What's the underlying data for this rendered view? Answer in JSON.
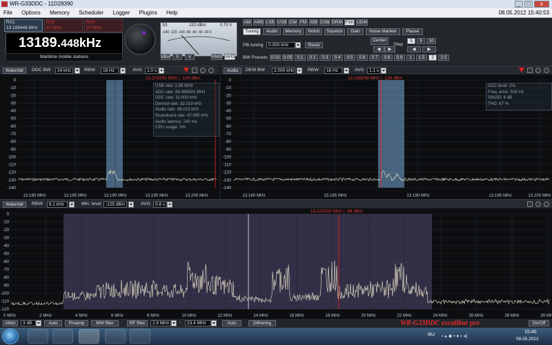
{
  "window": {
    "title": "WR-G33DDC - 11D28390",
    "clock": "08.05.2012 15:40:53"
  },
  "menu": [
    "File",
    "Options",
    "Memory",
    "Scheduler",
    "Logger",
    "Plugins",
    "Help"
  ],
  "receiver": {
    "rx1_label": "RX1",
    "rx1_freq": "13.189448 MHz",
    "rx2_label": "RX2",
    "rx2_freq": "10 MHz",
    "rx3_label": "RX3",
    "rx3_freq": "10 MHz",
    "frequency_main": "13189.",
    "frequency_fine": "448",
    "frequency_unit": "kHz",
    "station": "Maritime mobile stations"
  },
  "smeter": {
    "s_label": "S3",
    "dbm": "-110 dBm",
    "volts": "0.70 V",
    "scale": "-140 -120 -100 -80 -60 -40 -20 0",
    "dbm_btn": "dBm",
    "s_btn": "S",
    "v_btn": "V",
    "rms_btn": "RMS",
    "avg_btn": "AVG"
  },
  "modes": [
    "AM",
    "AMS",
    "LSB",
    "USB",
    "CW",
    "FM",
    "ISB",
    "DSB",
    "DRM",
    "FSK",
    "UDM"
  ],
  "active_mode": "FSK",
  "tabs": [
    "Tuning",
    "Audio",
    "Memory",
    "Notch",
    "Squelch",
    "Gain",
    "Noise blanker",
    "Pause"
  ],
  "pb": {
    "label": "PB tuning",
    "value": "0.000 kHz",
    "reset": "Reset"
  },
  "bw": {
    "label": "BW Presets",
    "presets": [
      "0.02",
      "0.05",
      "0.1",
      "0.2",
      "0.3",
      "0.4",
      "0.5",
      "0.6",
      "0.7",
      "0.8",
      "0.9",
      "1",
      "1.5",
      "2",
      "2.5"
    ],
    "selected": "2"
  },
  "center": {
    "label": "Center",
    "step_label": "Step",
    "steps": [
      "5",
      "9",
      "10"
    ]
  },
  "ddc_panel": {
    "mode": "Waterfall",
    "ddc_label": "DDC BW",
    "ddc_value": "24 kHz",
    "rbw_label": "RBW",
    "rbw_value": "16 Hz",
    "avg_label": "AVG",
    "avg_value": "1.0 s",
    "marker": "13.201000 MHz | -139 dBm",
    "info": [
      "USB rate: 2.99 MHz",
      "ADC rate: 99.998591 MHz",
      "DDC rate: 32.000 kHz",
      "Demod rate: 32.019 kHz",
      "Audio rate: 48.013 kHz",
      "Soundcard rate: 47.995 kHz",
      "Audio latency: 240 ms",
      "CPU usage: 3%"
    ],
    "y_ticks": [
      "0",
      "-10",
      "-20",
      "-30",
      "-40",
      "-50",
      "-60",
      "-70",
      "-80",
      "-90",
      "-100",
      "-110",
      "-120",
      "-130",
      "-140"
    ],
    "x_ticks": [
      "13.180 MHz",
      "13.185 MHz",
      "13.190 MHz",
      "13.195 MHz",
      "13.200 MHz"
    ]
  },
  "audio_panel": {
    "mode": "Audio",
    "dem_label": "DEM BW",
    "dem_value": "2.000 kHz",
    "rbw_label": "RBW",
    "rbw_value": "16 Hz",
    "avg_label": "AVG",
    "avg_value": "1.1 s",
    "marker": "13.188248 MHz | -126 dBm",
    "info": [
      "ADC level: 2%",
      "Freq. error: 539 Hz",
      "SINAD: 4 dB",
      "THD: 67 %"
    ],
    "y_ticks": [
      "0",
      "-10",
      "-20",
      "-30",
      "-40",
      "-50",
      "-60",
      "-70",
      "-80",
      "-90",
      "-100",
      "-110",
      "-120",
      "-130",
      "-140"
    ],
    "x_ticks": [
      "13.180 MHz",
      "13.185 MHz",
      "13.190 MHz",
      "13.195 MHz",
      "13.200 MHz"
    ]
  },
  "wide_panel": {
    "mode": "Waterfall",
    "rbw_label": "RBW",
    "rbw_value": "6.1 kHz",
    "min_label": "Min. level",
    "min_value": "-125 dBm",
    "avg_label": "AVG",
    "avg_value": "0.8 s",
    "marker": "18.225419 MHz | -98 dBm",
    "y_ticks": [
      "0",
      "-10",
      "-20",
      "-30",
      "-40",
      "-50",
      "-60",
      "-70",
      "-80",
      "-90",
      "-100",
      "-110",
      "-120"
    ],
    "x_ticks": [
      "0 MHz",
      "2 MHz",
      "4 MHz",
      "6 MHz",
      "8 MHz",
      "10 MHz",
      "12 MHz",
      "14 MHz",
      "16 MHz",
      "18 MHz",
      "20 MHz",
      "22 MHz",
      "24 MHz",
      "26 MHz",
      "28 MHz",
      "30 MHz"
    ]
  },
  "bottom": {
    "atten": "Atten",
    "atten_val": "3 dB",
    "auto1": "Auto",
    "preamp": "Preamp",
    "mw": "MW filter",
    "rf": "RF filter",
    "rf_low": "2.9 MHz",
    "rf_high": "23.4 MHz",
    "auto2": "Auto",
    "dither": "Dithering",
    "onoff": "On/Off"
  },
  "brand": "WR-G33DDC  excalibur pro",
  "tray": {
    "lang": "RU",
    "time": "15:40",
    "date": "08.05.2012"
  }
}
